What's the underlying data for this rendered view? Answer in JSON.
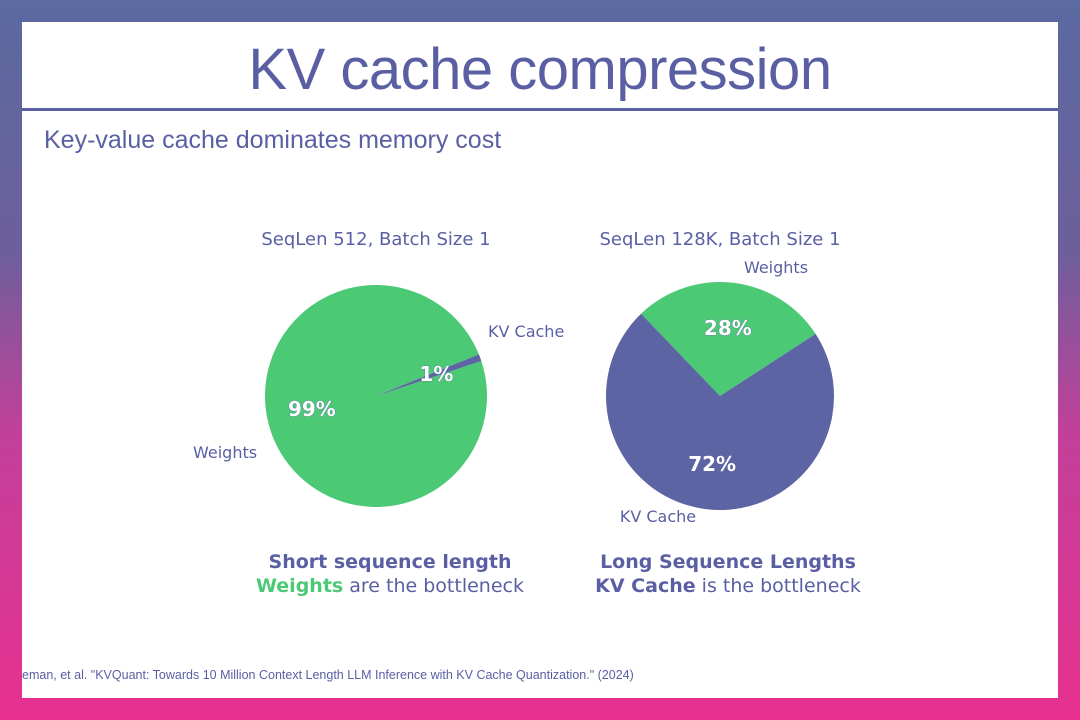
{
  "slide": {
    "title": "KV cache compression",
    "subtitle": "Key-value cache dominates memory cost",
    "citation": "eman, et al. \"KVQuant: Towards 10 Million Context Length LLM Inference with KV Cache Quantization.\" (2024)"
  },
  "colors": {
    "weights": "#4cc975",
    "kv_cache": "#5d64a3",
    "text": "#5a5fa3"
  },
  "chart_data": [
    {
      "type": "pie",
      "title": "SeqLen 512, Batch Size 1",
      "slices": [
        {
          "label": "Weights",
          "value": 99,
          "pct_label": "99%",
          "color": "#4cc975"
        },
        {
          "label": "KV Cache",
          "value": 1,
          "pct_label": "1%",
          "color": "#5d64a3"
        }
      ]
    },
    {
      "type": "pie",
      "title": "SeqLen 128K, Batch Size 1",
      "slices": [
        {
          "label": "Weights",
          "value": 28,
          "pct_label": "28%",
          "color": "#4cc975"
        },
        {
          "label": "KV Cache",
          "value": 72,
          "pct_label": "72%",
          "color": "#5d64a3"
        }
      ]
    }
  ],
  "captions": [
    {
      "line1": "Short sequence length",
      "highlight": "Weights",
      "rest": " are the bottleneck"
    },
    {
      "line1": "Long Sequence Lengths",
      "highlight": "KV Cache",
      "rest": " is the bottleneck"
    }
  ]
}
